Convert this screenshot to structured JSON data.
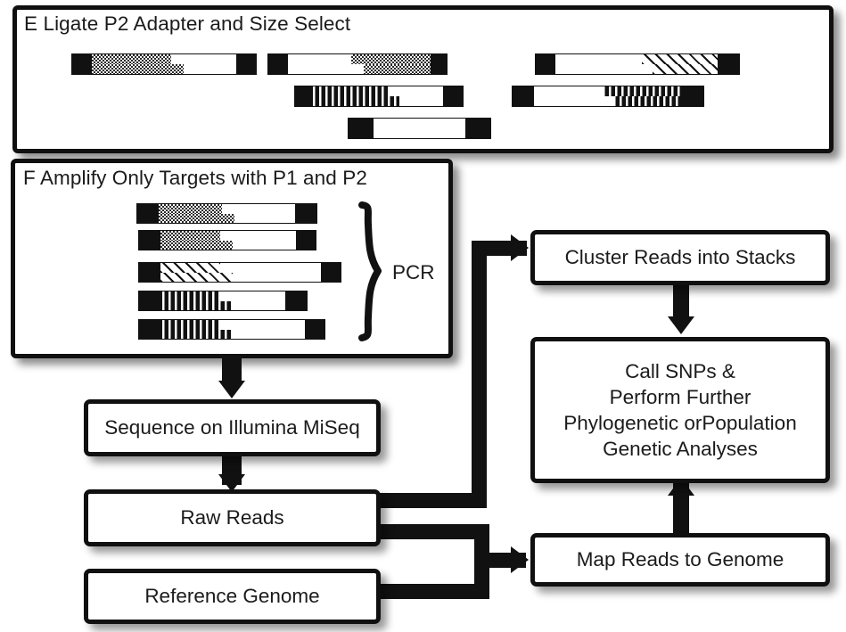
{
  "figure": {
    "domain": "diagram",
    "description": "RAD-seq / ddRAD library preparation and bioinformatics workflow schematic, panels E and F plus downstream analysis flowchart"
  },
  "panels": [
    {
      "id": "E",
      "letter": "E",
      "title": "E Ligate P2 Adapter and Size Select",
      "title_text": "Ligate P2 Adapter and Size Select"
    },
    {
      "id": "F",
      "letter": "F",
      "title": "F Amplify Only Targets with P1 and P2",
      "title_text": "Amplify Only Targets with P1 and P2",
      "annotation": "PCR"
    }
  ],
  "panel_e_fragments": [
    {
      "name": "fragment-p1-dots-left",
      "row": 1,
      "pattern": "dots",
      "left_cap": "black",
      "right_cap": "black",
      "orientation": "pattern-left"
    },
    {
      "name": "fragment-p2-dots-right",
      "row": 1,
      "pattern": "dots",
      "left_cap": "black",
      "right_cap": "black",
      "orientation": "pattern-right"
    },
    {
      "name": "fragment-hatch-right",
      "row": 1,
      "pattern": "hatch",
      "left_cap": "black",
      "right_cap": "black",
      "orientation": "pattern-right"
    },
    {
      "name": "fragment-vstripe-left",
      "row": 2,
      "pattern": "vstripe",
      "left_cap": "black",
      "right_cap": "black",
      "orientation": "pattern-left"
    },
    {
      "name": "fragment-vstripe-right",
      "row": 2,
      "pattern": "vstripe",
      "left_cap": "black",
      "right_cap": "black",
      "orientation": "pattern-right"
    },
    {
      "name": "fragment-plain",
      "row": 3,
      "pattern": "none",
      "left_cap": "black",
      "right_cap": "black",
      "orientation": "plain"
    }
  ],
  "panel_f_fragments": [
    {
      "name": "pcr-product-1",
      "pattern": "dots",
      "length": "short"
    },
    {
      "name": "pcr-product-2",
      "pattern": "dots",
      "length": "short"
    },
    {
      "name": "pcr-product-3",
      "pattern": "hatch",
      "length": "long"
    },
    {
      "name": "pcr-product-4",
      "pattern": "vstripe",
      "length": "short"
    },
    {
      "name": "pcr-product-5",
      "pattern": "vstripe",
      "length": "medium"
    }
  ],
  "flow_boxes": {
    "sequence": {
      "label": "Sequence on Illumina MiSeq",
      "lines": [
        "Sequence on Illumina MiSeq"
      ]
    },
    "raw_reads": {
      "label": "Raw Reads",
      "lines": [
        "Raw Reads"
      ]
    },
    "reference_genome": {
      "label": "Reference Genome",
      "lines": [
        "Reference Genome"
      ]
    },
    "cluster_reads": {
      "label": "Cluster Reads into Stacks",
      "lines": [
        "Cluster Reads into Stacks"
      ]
    },
    "call_snps": {
      "label": "Call SNPs & Perform Further Phylogenetic or Population Genetic Analyses",
      "lines": [
        "Call SNPs &",
        "Perform Further",
        "Phylogenetic orPopulation",
        "Genetic Analyses"
      ]
    },
    "map_reads": {
      "label": "Map Reads to Genome",
      "lines": [
        "Map Reads to Genome"
      ]
    }
  },
  "edges": [
    {
      "name": "edge-f-to-sequence",
      "from": "panel-f",
      "to": "sequence"
    },
    {
      "name": "edge-sequence-to-raw-reads",
      "from": "sequence",
      "to": "raw_reads"
    },
    {
      "name": "edge-raw-reads-to-cluster",
      "from": "raw_reads",
      "to": "cluster_reads"
    },
    {
      "name": "edge-raw-reads-to-map",
      "from": "raw_reads",
      "to": "map_reads"
    },
    {
      "name": "edge-reference-to-map",
      "from": "reference_genome",
      "to": "map_reads"
    },
    {
      "name": "edge-cluster-to-call-snps",
      "from": "cluster_reads",
      "to": "call_snps"
    },
    {
      "name": "edge-map-to-call-snps",
      "from": "map_reads",
      "to": "call_snps"
    }
  ],
  "colors": {
    "ink": "#111111",
    "text": "#1b1b1b",
    "background": "#ffffff"
  }
}
